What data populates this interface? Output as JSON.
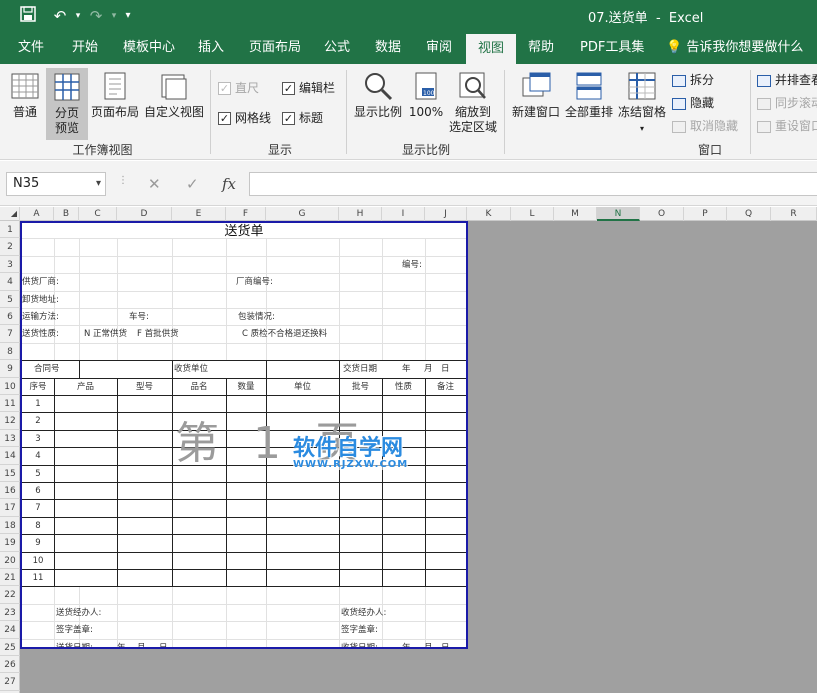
{
  "window": {
    "title": "07.送货单  -  Excel"
  },
  "quick_access": {
    "save_icon": "save-icon",
    "undo_icon": "undo-icon",
    "redo_icon": "redo-icon",
    "customize_icon": "customize-icon"
  },
  "tabs": [
    {
      "label": "文件"
    },
    {
      "label": "开始"
    },
    {
      "label": "模板中心"
    },
    {
      "label": "插入"
    },
    {
      "label": "页面布局"
    },
    {
      "label": "公式"
    },
    {
      "label": "数据"
    },
    {
      "label": "审阅"
    },
    {
      "label": "视图"
    },
    {
      "label": "帮助"
    },
    {
      "label": "PDF工具集"
    },
    {
      "label": "告诉我你想要做什么"
    }
  ],
  "ribbon": {
    "workbook_views": {
      "label": "工作簿视图",
      "normal": "普通",
      "page_break_l1": "分页",
      "page_break_l2": "预览",
      "page_layout": "页面布局",
      "custom_views": "自定义视图"
    },
    "show": {
      "label": "显示",
      "ruler": "直尺",
      "gridlines": "网格线",
      "formula_bar": "编辑栏",
      "headings": "标题"
    },
    "zoom": {
      "label": "显示比例",
      "zoom": "显示比例",
      "zoom100": "100%",
      "zoom_sel_l1": "缩放到",
      "zoom_sel_l2": "选定区域"
    },
    "window": {
      "label": "窗口",
      "new_window": "新建窗口",
      "arrange_all": "全部重排",
      "freeze_panes": "冻结窗格",
      "split": "拆分",
      "hide": "隐藏",
      "unhide": "取消隐藏",
      "side_by_side": "并排查看",
      "sync_scroll": "同步滚动",
      "reset_position": "重设窗口位置"
    }
  },
  "formula_bar": {
    "name_box": "N35",
    "cancel": "✕",
    "enter": "✓",
    "fx": "fx",
    "value": ""
  },
  "columns": [
    "A",
    "B",
    "C",
    "D",
    "E",
    "F",
    "G",
    "H",
    "I",
    "J",
    "K",
    "L",
    "M",
    "N",
    "O",
    "P",
    "Q",
    "R"
  ],
  "selected_column": "N",
  "rows": [
    "1",
    "2",
    "3",
    "4",
    "5",
    "6",
    "7",
    "8",
    "9",
    "10",
    "11",
    "12",
    "13",
    "14",
    "15",
    "16",
    "17",
    "18",
    "19",
    "20",
    "21",
    "22",
    "23",
    "24",
    "25",
    "26",
    "27"
  ],
  "sheet": {
    "title": "送货单",
    "number_label": "编号:",
    "supplier": "供货厂商:",
    "vendor_no": "厂商编号:",
    "address": "卸货地址:",
    "transport": "运输方法:",
    "car_no": "车号:",
    "package": "包装情况:",
    "nature": "送货性质:",
    "opt_n": "N 正常供货",
    "opt_f": "F 首批供货",
    "opt_c": "C 质检不合格退还换料",
    "contract": "合同号",
    "receiver_unit": "收货单位",
    "delivery_date": "交货日期",
    "date_y": "年",
    "date_m": "月",
    "date_d": "日",
    "headers": [
      "序号",
      "产品",
      "型号",
      "品名",
      "数量",
      "单位",
      "批号",
      "性质",
      "备注"
    ],
    "row_nums": [
      "1",
      "2",
      "3",
      "4",
      "5",
      "6",
      "7",
      "8",
      "9",
      "10",
      "11"
    ],
    "sender": "送货经办人:",
    "sign_left": "签字盖章:",
    "send_date": "送货日期:",
    "receiver": "收货经办人:",
    "sign_right": "签字盖章:",
    "recv_date": "收货日期:"
  },
  "watermark": "第 1 页",
  "site_logo": {
    "name": "软件自学网",
    "url": "WWW.RJZXW.COM"
  }
}
